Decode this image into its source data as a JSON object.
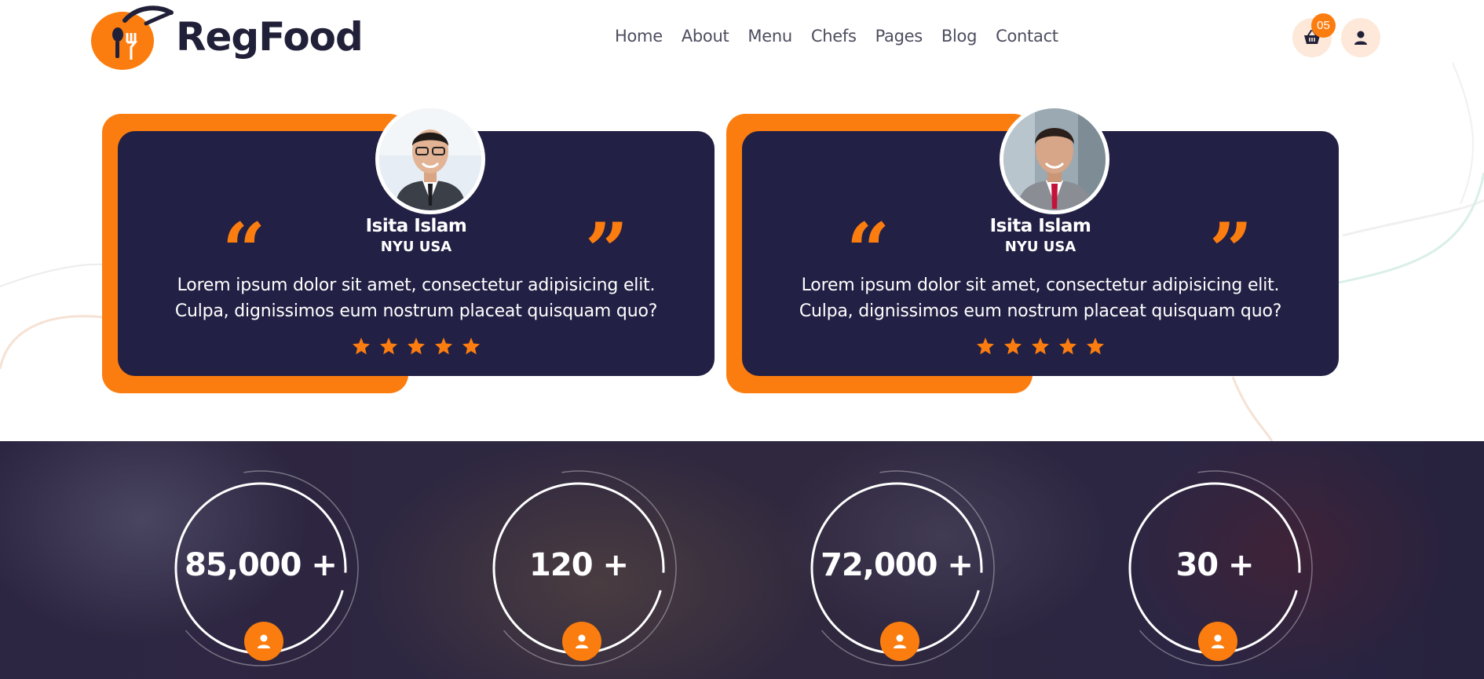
{
  "header": {
    "logo_text": "RegFood",
    "nav": [
      "Home",
      "About",
      "Menu",
      "Chefs",
      "Pages",
      "Blog",
      "Contact"
    ],
    "cart_count": "05",
    "icons": [
      "basket-icon",
      "user-icon"
    ]
  },
  "testimonials": [
    {
      "name": "Isita Islam",
      "role": "NYU USA",
      "text": "Lorem ipsum dolor sit amet, consectetur adipisicing elit. Culpa, dignissimos eum nostrum placeat quisquam quo?",
      "rating": 5,
      "open_quote": "“",
      "close_quote": "”"
    },
    {
      "name": "Isita Islam",
      "role": "NYU USA",
      "text": "Lorem ipsum dolor sit amet, consectetur adipisicing elit. Culpa, dignissimos eum nostrum placeat quisquam quo?",
      "rating": 5,
      "open_quote": "“",
      "close_quote": "”"
    }
  ],
  "counters": [
    {
      "value": "85,000 +",
      "icon": "user-icon"
    },
    {
      "value": "120 +",
      "icon": "user-icon"
    },
    {
      "value": "72,000 +",
      "icon": "user-icon"
    },
    {
      "value": "30 +",
      "icon": "user-icon"
    }
  ],
  "colors": {
    "accent": "#fc7d0f",
    "navy": "#222044",
    "nav_text": "#4d4d5f",
    "pale_accent": "#fde8d9"
  }
}
